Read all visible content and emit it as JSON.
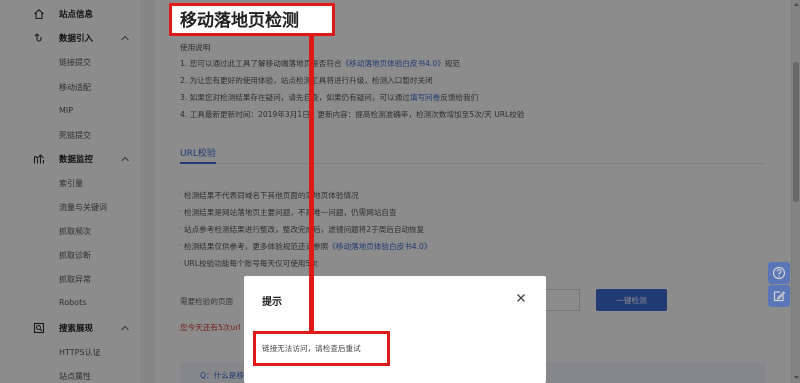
{
  "sidebar": {
    "sections": [
      {
        "title": "站点信息",
        "icon": "home-icon",
        "collapsible": false,
        "items": []
      },
      {
        "title": "数据引入",
        "icon": "data-import-icon",
        "collapsible": true,
        "items": [
          "链接提交",
          "移动适配",
          "MIP",
          "死链提交"
        ]
      },
      {
        "title": "数据监控",
        "icon": "chart-icon",
        "collapsible": true,
        "items": [
          "索引量",
          "流量与关键词",
          "抓取频次",
          "抓取诊断",
          "抓取异常",
          "Robots"
        ]
      },
      {
        "title": "搜索展现",
        "icon": "search-display-icon",
        "collapsible": true,
        "items": [
          "HTTPS认证",
          "站点属性"
        ]
      }
    ]
  },
  "main": {
    "title": "移动落地页检测",
    "usage_heading": "使用说明",
    "usage_lines": [
      {
        "pre": "1. 您可以通过此工具了解移动端落地页是否符合",
        "link": "《移动落地页体验白皮书4.0》",
        "post": "规范"
      },
      {
        "pre": "2. 为让您有更好的使用体验，站点检测工具将进行升级，检测入口暂时关闭",
        "link": "",
        "post": ""
      },
      {
        "pre": "3. 如果您对检测结果存在疑问，请先自查，如果仍有疑问，可以通过",
        "link": "填写问卷",
        "post": "反馈给我们"
      },
      {
        "pre": "4. 工具最新更新时间：2019年3月1日；更新内容：提高检测准确率，检测次数增加至5次/天 URL校验",
        "link": "",
        "post": ""
      }
    ],
    "tab_label": "URL校验",
    "bullets": [
      {
        "pre": "检测结果不代表同域名下其他页面的落地页体验情况",
        "link": "",
        "post": ""
      },
      {
        "pre": "检测结果是网站落地页主要问题，不是唯一问题，仍需网站自查",
        "link": "",
        "post": ""
      },
      {
        "pre": "站点参考检测结果进行整改，整改完成后，滤镜问题将2于周后自动恢复",
        "link": "",
        "post": ""
      },
      {
        "pre": "检测结果仅供参考，更多体验规范还请参照",
        "link": "《移动落地页体验白皮书4.0》",
        "post": ""
      },
      {
        "pre": "URL校验功能每个账号每天仅可使用5次",
        "link": "",
        "post": ""
      }
    ],
    "url_label": "需要检验的页面",
    "url_input_value": "",
    "detect_button": "一键检测",
    "remaining_text": "您今天还有5次url",
    "faq_text": "Q：什么是移动"
  },
  "modal": {
    "title": "提示",
    "message": "链接无法访问，请检查后重试",
    "close_symbol": "×"
  },
  "colors": {
    "accent": "#3c68d6",
    "annotation_red": "#e01818",
    "overlay": "rgba(0,0,0,0.45)"
  }
}
